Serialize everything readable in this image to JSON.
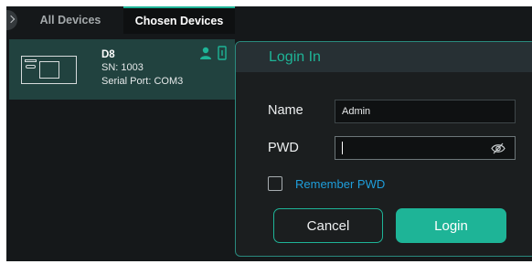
{
  "tabs": {
    "all_devices": "All Devices",
    "chosen_devices": "Chosen Devices"
  },
  "device": {
    "name": "D8",
    "sn": "SN: 1003",
    "serial_port": "Serial Port: COM3",
    "icons": [
      "device-thumbnail-icon",
      "user-icon",
      "link-icon"
    ]
  },
  "login": {
    "title": "Login In",
    "name_label": "Name",
    "name_value": "Admin",
    "pwd_label": "PWD",
    "pwd_value": "",
    "remember_label": "Remember PWD",
    "remember_checked": false,
    "cancel_label": "Cancel",
    "login_label": "Login"
  },
  "colors": {
    "accent": "#1eb497",
    "link": "#1e9edb",
    "background": "#15181a",
    "card": "#21423f"
  }
}
